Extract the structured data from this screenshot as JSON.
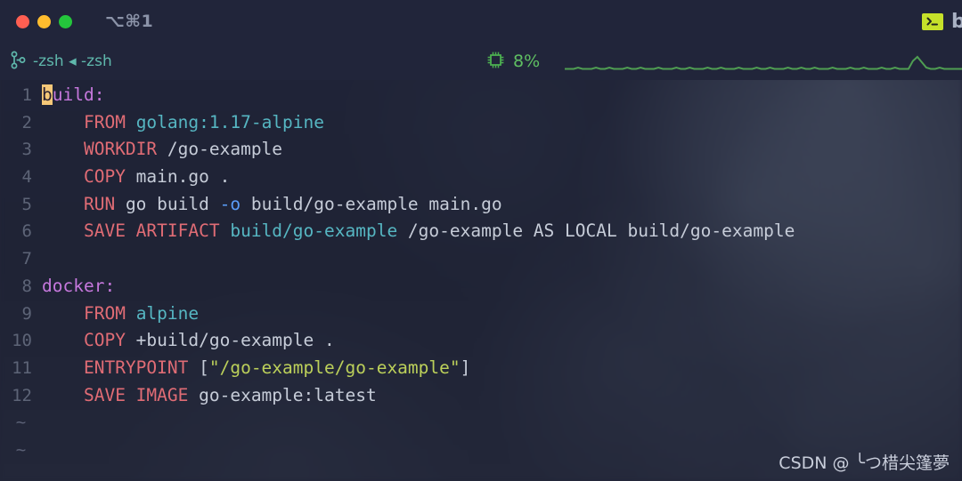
{
  "window": {
    "titlebar": {
      "traffic_lights": [
        {
          "name": "close",
          "color": "#ff5f52"
        },
        {
          "name": "minimize",
          "color": "#ffbd2e"
        },
        {
          "name": "maximize",
          "color": "#24c63c"
        }
      ],
      "shortcut_label": "⌥⌘1",
      "right_icon": "terminal-prompt-icon",
      "right_icon_color": "#c6e12a",
      "right_label": "b"
    },
    "statusbar": {
      "branch_icon": "git-branch-icon",
      "session_label": "-zsh ◂ -zsh",
      "session_color": "#5fb8ac",
      "cpu_icon": "cpu-chip-icon",
      "cpu_value": "8%",
      "cpu_color": "#5fbf62",
      "sparkline": {
        "color": "#4f9e52",
        "points": [
          3,
          3,
          3,
          4,
          3,
          3,
          3,
          4,
          3,
          3,
          4,
          3,
          3,
          3,
          4,
          3,
          3,
          4,
          3,
          3,
          3,
          4,
          3,
          3,
          3,
          4,
          3,
          3,
          4,
          3,
          3,
          3,
          4,
          3,
          3,
          4,
          3,
          3,
          3,
          4,
          3,
          3,
          3,
          4,
          3,
          3,
          4,
          3,
          3,
          3,
          4,
          3,
          3,
          4,
          3,
          3,
          4,
          3,
          3,
          3,
          4,
          3,
          3,
          3,
          4,
          3,
          3,
          4,
          3,
          3,
          3,
          4,
          3,
          3,
          4,
          3,
          3,
          3,
          9,
          12,
          8,
          4,
          3,
          3,
          4,
          3,
          3,
          3,
          3,
          3
        ]
      }
    }
  },
  "editor": {
    "cursor_char": "b",
    "lines": [
      {
        "number": "1",
        "tokens": [
          {
            "text": "b",
            "style": "cursor"
          },
          {
            "text": "uild:",
            "style": "target"
          }
        ]
      },
      {
        "number": "2",
        "tokens": [
          {
            "text": "    ",
            "style": "plain"
          },
          {
            "text": "FROM",
            "style": "cmd"
          },
          {
            "text": " ",
            "style": "plain"
          },
          {
            "text": "golang:1.17-alpine",
            "style": "image"
          }
        ]
      },
      {
        "number": "3",
        "tokens": [
          {
            "text": "    ",
            "style": "plain"
          },
          {
            "text": "WORKDIR",
            "style": "cmd"
          },
          {
            "text": " /go-example",
            "style": "plain"
          }
        ]
      },
      {
        "number": "4",
        "tokens": [
          {
            "text": "    ",
            "style": "plain"
          },
          {
            "text": "COPY",
            "style": "cmd"
          },
          {
            "text": " main.go .",
            "style": "plain"
          }
        ]
      },
      {
        "number": "5",
        "tokens": [
          {
            "text": "    ",
            "style": "plain"
          },
          {
            "text": "RUN",
            "style": "cmd"
          },
          {
            "text": " go build ",
            "style": "plain"
          },
          {
            "text": "-o",
            "style": "flag"
          },
          {
            "text": " build/go-example main.go",
            "style": "plain"
          }
        ]
      },
      {
        "number": "6",
        "tokens": [
          {
            "text": "    ",
            "style": "plain"
          },
          {
            "text": "SAVE ARTIFACT",
            "style": "cmd"
          },
          {
            "text": " ",
            "style": "plain"
          },
          {
            "text": "build/go-example",
            "style": "image"
          },
          {
            "text": " /go-example AS LOCAL build/go-example",
            "style": "plain"
          }
        ]
      },
      {
        "number": "7",
        "tokens": []
      },
      {
        "number": "8",
        "tokens": [
          {
            "text": "docker:",
            "style": "target"
          }
        ]
      },
      {
        "number": "9",
        "tokens": [
          {
            "text": "    ",
            "style": "plain"
          },
          {
            "text": "FROM",
            "style": "cmd"
          },
          {
            "text": " ",
            "style": "plain"
          },
          {
            "text": "alpine",
            "style": "image"
          }
        ]
      },
      {
        "number": "10",
        "tokens": [
          {
            "text": "    ",
            "style": "plain"
          },
          {
            "text": "COPY",
            "style": "cmd"
          },
          {
            "text": " +build/go-example .",
            "style": "plain"
          }
        ]
      },
      {
        "number": "11",
        "tokens": [
          {
            "text": "    ",
            "style": "plain"
          },
          {
            "text": "ENTRYPOINT",
            "style": "cmd"
          },
          {
            "text": " [",
            "style": "plain"
          },
          {
            "text": "\"/go-example/go-example\"",
            "style": "string"
          },
          {
            "text": "]",
            "style": "plain"
          }
        ]
      },
      {
        "number": "12",
        "tokens": [
          {
            "text": "    ",
            "style": "plain"
          },
          {
            "text": "SAVE IMAGE",
            "style": "cmd"
          },
          {
            "text": " go-example:latest",
            "style": "plain"
          }
        ]
      }
    ],
    "empty_markers": [
      "~",
      "~"
    ]
  },
  "watermark": {
    "text": "CSDN @ ╰つ棤尖篷夢"
  }
}
